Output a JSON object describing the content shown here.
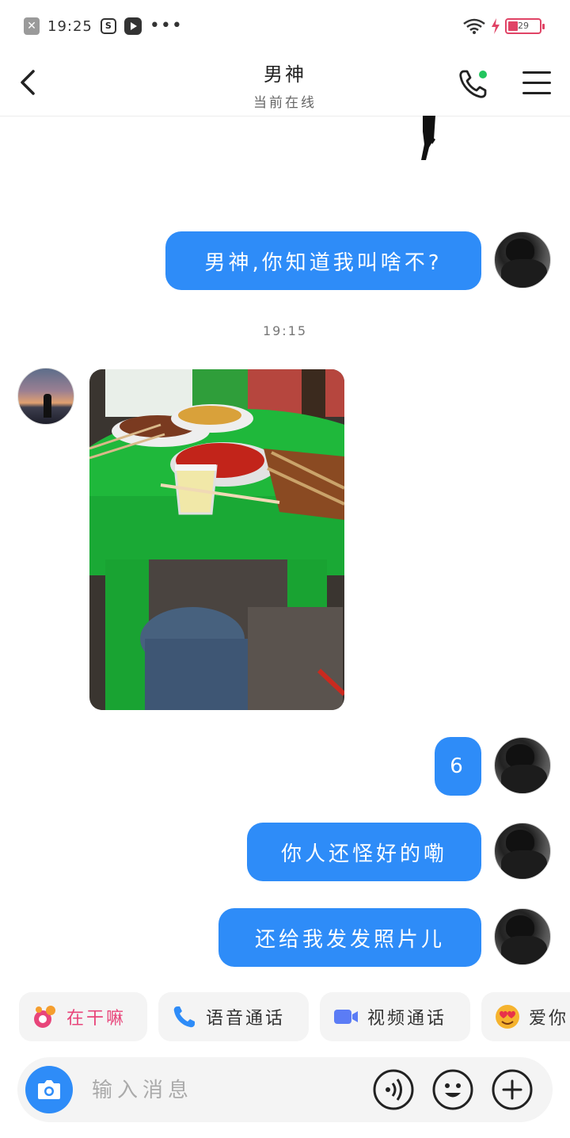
{
  "status_bar": {
    "time": "19:25",
    "battery": "29",
    "icons": [
      "close-notification-icon",
      "screenshot-icon",
      "play-icon",
      "more-dots-icon",
      "wifi-icon",
      "charging-icon",
      "battery-icon"
    ]
  },
  "header": {
    "title": "男神",
    "subtitle": "当前在线",
    "back_icon": "chevron-left-icon",
    "call_icon": "phone-icon",
    "menu_icon": "hamburger-menu-icon"
  },
  "messages": [
    {
      "from": "me",
      "type": "text",
      "text": "男神,你知道我叫啥不?"
    },
    {
      "type": "time",
      "text": "19:15"
    },
    {
      "from": "other",
      "type": "image",
      "description": "photo"
    },
    {
      "from": "me",
      "type": "text",
      "text": "6"
    },
    {
      "from": "me",
      "type": "text",
      "text": "你人还怪好的嘞"
    },
    {
      "from": "me",
      "type": "text",
      "text": "还给我发发照片儿"
    }
  ],
  "quick_actions": [
    {
      "label": "在干嘛",
      "icon": "sticker-icon",
      "color": "#e8457a"
    },
    {
      "label": "语音通话",
      "icon": "phone-icon",
      "color": "#2e8cf8"
    },
    {
      "label": "视频通话",
      "icon": "video-camera-icon",
      "color": "#5b7cf5"
    },
    {
      "label": "爱你",
      "icon": "heart-eyes-emoji-icon",
      "color": "#f5b32e"
    }
  ],
  "input_bar": {
    "placeholder": "输入消息",
    "icons": [
      "camera-icon",
      "voice-icon",
      "emoji-icon",
      "plus-icon"
    ]
  },
  "colors": {
    "accent": "#2e8cf8",
    "online_dot": "#22c55e",
    "battery": "#e04466"
  }
}
